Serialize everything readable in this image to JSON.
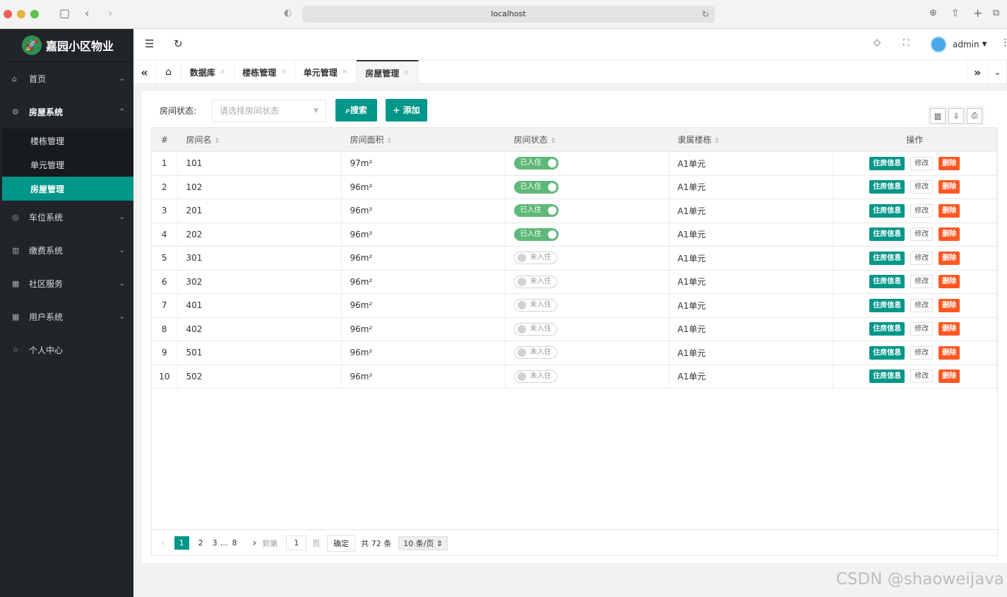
{
  "browser": {
    "url": "localhost"
  },
  "sidebar": {
    "brand": "嘉园小区物业",
    "items": [
      {
        "label": "首页",
        "icon": "home-icon",
        "glyph": "⌂"
      },
      {
        "label": "房屋系统",
        "icon": "gear-icon",
        "glyph": "⚙"
      },
      {
        "label": "车位系统",
        "icon": "cube-icon",
        "glyph": "◎"
      },
      {
        "label": "缴费系统",
        "icon": "bars-icon",
        "glyph": "▥"
      },
      {
        "label": "社区服务",
        "icon": "app-icon",
        "glyph": "▦"
      },
      {
        "label": "用户系统",
        "icon": "app-icon",
        "glyph": "▦"
      },
      {
        "label": "个人中心",
        "icon": "star-icon",
        "glyph": "☆"
      }
    ],
    "submenu": [
      "楼栋管理",
      "单元管理",
      "房屋管理"
    ]
  },
  "header": {
    "user": "admin"
  },
  "tabs": [
    "数据库",
    "楼栋管理",
    "单元管理",
    "房屋管理"
  ],
  "filter": {
    "label": "房间状态:",
    "placeholder": "请选择房间状态",
    "search": "搜索",
    "add": "添加"
  },
  "table": {
    "columns": [
      "#",
      "房间名",
      "房间面积",
      "房间状态",
      "隶属楼栋",
      "操作"
    ],
    "rows": [
      {
        "no": "1",
        "name": "101",
        "area": "97m²",
        "status": "已入住",
        "on": true,
        "building": "A1单元"
      },
      {
        "no": "2",
        "name": "102",
        "area": "96m²",
        "status": "已入住",
        "on": true,
        "building": "A1单元"
      },
      {
        "no": "3",
        "name": "201",
        "area": "96m²",
        "status": "已入住",
        "on": true,
        "building": "A1单元"
      },
      {
        "no": "4",
        "name": "202",
        "area": "96m²",
        "status": "已入住",
        "on": true,
        "building": "A1单元"
      },
      {
        "no": "5",
        "name": "301",
        "area": "96m²",
        "status": "未入住",
        "on": false,
        "building": "A1单元"
      },
      {
        "no": "6",
        "name": "302",
        "area": "96m²",
        "status": "未入住",
        "on": false,
        "building": "A1单元"
      },
      {
        "no": "7",
        "name": "401",
        "area": "96m²",
        "status": "未入住",
        "on": false,
        "building": "A1单元"
      },
      {
        "no": "8",
        "name": "402",
        "area": "96m²",
        "status": "未入住",
        "on": false,
        "building": "A1单元"
      },
      {
        "no": "9",
        "name": "501",
        "area": "96m²",
        "status": "未入住",
        "on": false,
        "building": "A1单元"
      },
      {
        "no": "10",
        "name": "502",
        "area": "96m²",
        "status": "未入住",
        "on": false,
        "building": "A1单元"
      }
    ],
    "actions": {
      "info": "住房信息",
      "edit": "修改",
      "delete": "删除"
    }
  },
  "pager": {
    "pages": [
      "1",
      "2",
      "3",
      "…",
      "8"
    ],
    "goto": "到第",
    "page_value": "1",
    "page_unit": "页",
    "confirm": "确定",
    "total": "共 72 条",
    "per_page": "10 条/页"
  },
  "watermark": "CSDN @shaoweijava"
}
